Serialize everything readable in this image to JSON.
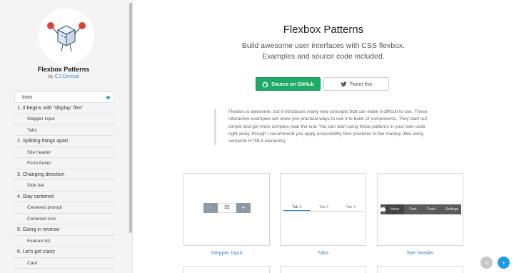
{
  "sidebar": {
    "title": "Flexbox Patterns",
    "author_prefix": "by ",
    "author_name": "CJ Cenizal",
    "items": [
      {
        "label": "Intro",
        "kind": "active"
      },
      {
        "label": "1. It begins with \"display: flex\"",
        "kind": "section"
      },
      {
        "label": "Stepper input",
        "kind": "sub"
      },
      {
        "label": "Tabs",
        "kind": "sub"
      },
      {
        "label": "2. Splitting things apart",
        "kind": "section"
      },
      {
        "label": "Site header",
        "kind": "sub"
      },
      {
        "label": "Form footer",
        "kind": "sub"
      },
      {
        "label": "3. Changing direction",
        "kind": "section"
      },
      {
        "label": "Side bar",
        "kind": "sub"
      },
      {
        "label": "4. Stay centered",
        "kind": "section"
      },
      {
        "label": "Centered prompt",
        "kind": "sub"
      },
      {
        "label": "Centered icon",
        "kind": "sub"
      },
      {
        "label": "5. Going in reverse",
        "kind": "section"
      },
      {
        "label": "Feature list",
        "kind": "sub"
      },
      {
        "label": "6. Let's get crazy",
        "kind": "section"
      },
      {
        "label": "Card",
        "kind": "sub"
      }
    ]
  },
  "main": {
    "title": "Flexbox Patterns",
    "subtitle": "Build awesome user interfaces with CSS flexbox. Examples and source code included.",
    "github_button": "Source on GitHub",
    "tweet_button": "Tweet this",
    "intro": "Flexbox is awesome, but it introduces many new concepts that can make it difficult to use. These interactive examples will show you practical ways to use it to build UI components. They start out simple and get more complex near the end. You can start using these patterns in your own code right away, though I recommend you apply accessibility best practices to the markup (like using semantic HTML5 elements).",
    "cards": [
      {
        "label": "Stepper input",
        "minus": "-",
        "value": "32",
        "plus": "+"
      },
      {
        "label": "Tabs",
        "tabs": [
          "Tab 1",
          "Tab 2",
          "Tab 3"
        ]
      },
      {
        "label": "Site header",
        "nav": [
          "Inbox",
          "Sent",
          "Trash"
        ],
        "settings": "Settings"
      }
    ]
  },
  "pager": {
    "prev": "‹",
    "next": "›"
  },
  "colors": {
    "accent": "#3f85c9",
    "github_green": "#1dab67",
    "next_blue": "#1e9be6"
  }
}
